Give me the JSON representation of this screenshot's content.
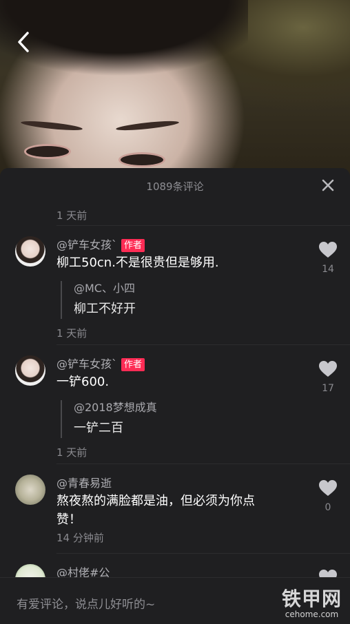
{
  "sheet": {
    "title": "1089条评论"
  },
  "top_time": "1 天前",
  "comments": [
    {
      "username": "@铲车女孩`",
      "badge": "作者",
      "text": "柳工50cn.不是很贵但是够用.",
      "reply": {
        "username": "@MC、小四",
        "text": "柳工不好开"
      },
      "time": "1 天前",
      "likes": "14"
    },
    {
      "username": "@铲车女孩`",
      "badge": "作者",
      "text": "一铲600.",
      "reply": {
        "username": "@2018梦想成真",
        "text": "一铲二百"
      },
      "time": "1 天前",
      "likes": "17"
    },
    {
      "username": "@青春易逝",
      "text_line1": "熬夜熬的满脸都是油，但必须为你点",
      "text_line2": "赞！",
      "time": "14 分钟前",
      "likes": "0"
    },
    {
      "username": "@村佬#公"
    }
  ],
  "input": {
    "placeholder": "有爱评论，说点儿好听的~"
  },
  "watermark": {
    "cn": "铁甲网",
    "en": "cehome.com"
  },
  "icons": {
    "back": "chevron-left-icon",
    "close": "close-icon",
    "like": "heart-icon"
  },
  "colors": {
    "badge": "#fe2c55",
    "sheet_bg": "#1f1f21"
  }
}
